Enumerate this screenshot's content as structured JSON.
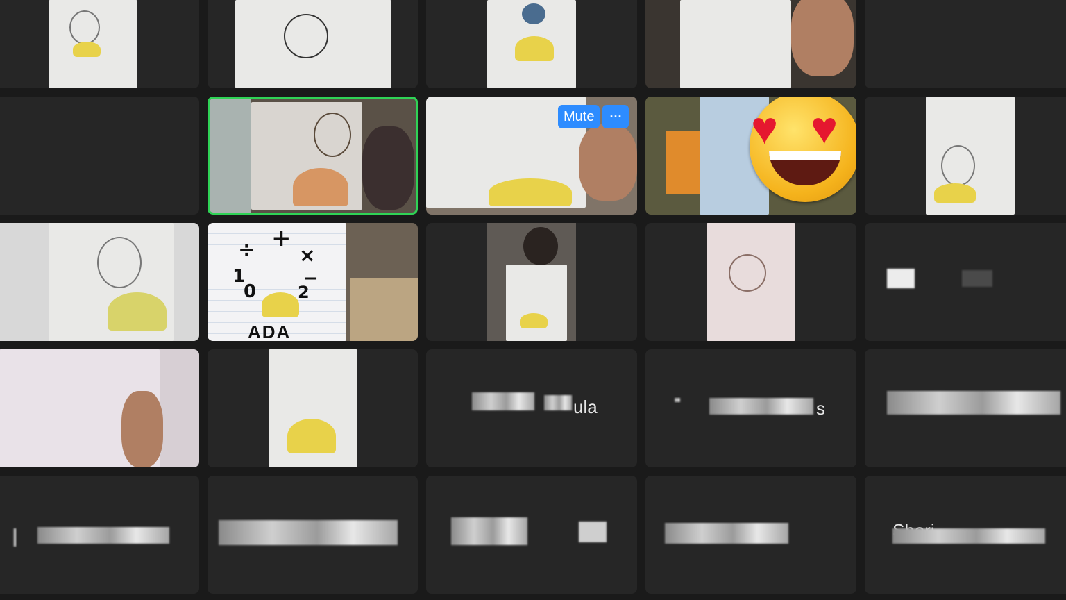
{
  "window": {
    "background": "#1a1a1a",
    "tile_color": "#262626",
    "active_speaker_color": "#2fd356",
    "accent": "#2d8cff"
  },
  "tiles": [
    {
      "id": "r1c1",
      "kind": "video"
    },
    {
      "id": "r1c2",
      "kind": "video"
    },
    {
      "id": "r1c3",
      "kind": "video"
    },
    {
      "id": "r1c4",
      "kind": "video"
    },
    {
      "id": "r1c5",
      "kind": "empty"
    },
    {
      "id": "r2c1",
      "kind": "empty"
    },
    {
      "id": "r2c2",
      "kind": "video",
      "active_speaker": true
    },
    {
      "id": "r2c3",
      "kind": "video",
      "hover": true
    },
    {
      "id": "r2c4",
      "kind": "video",
      "reaction": "heart-eyes-emoji"
    },
    {
      "id": "r2c5",
      "kind": "video"
    },
    {
      "id": "r3c1",
      "kind": "video"
    },
    {
      "id": "r3c2",
      "kind": "video"
    },
    {
      "id": "r3c3",
      "kind": "video"
    },
    {
      "id": "r3c4",
      "kind": "video"
    },
    {
      "id": "r3c5",
      "kind": "name"
    },
    {
      "id": "r4c1",
      "kind": "video"
    },
    {
      "id": "r4c2",
      "kind": "video"
    },
    {
      "id": "r4c3",
      "kind": "name"
    },
    {
      "id": "r4c4",
      "kind": "name"
    },
    {
      "id": "r4c5",
      "kind": "name"
    },
    {
      "id": "r5c1",
      "kind": "name"
    },
    {
      "id": "r5c2",
      "kind": "name"
    },
    {
      "id": "r5c3",
      "kind": "name"
    },
    {
      "id": "r5c4",
      "kind": "name"
    },
    {
      "id": "r5c5",
      "kind": "name"
    }
  ],
  "hover_controls": {
    "mute_label": "Mute",
    "more_label": "···"
  },
  "drawing_labels": {
    "ada_caps": "ADA",
    "ada_outline": "ADA",
    "math_divide": "÷",
    "math_plus": "+",
    "math_times": "×",
    "math_minus": "−",
    "math_one": "1",
    "math_zero": "0",
    "math_two": "2"
  },
  "participant_names": {
    "r4c3_suffix": "ula",
    "r4c4_suffix": "s",
    "r5c5_prefix": "Sheri"
  },
  "icons": {
    "reaction": "heart-eyes-emoji",
    "more": "more-options-icon"
  }
}
